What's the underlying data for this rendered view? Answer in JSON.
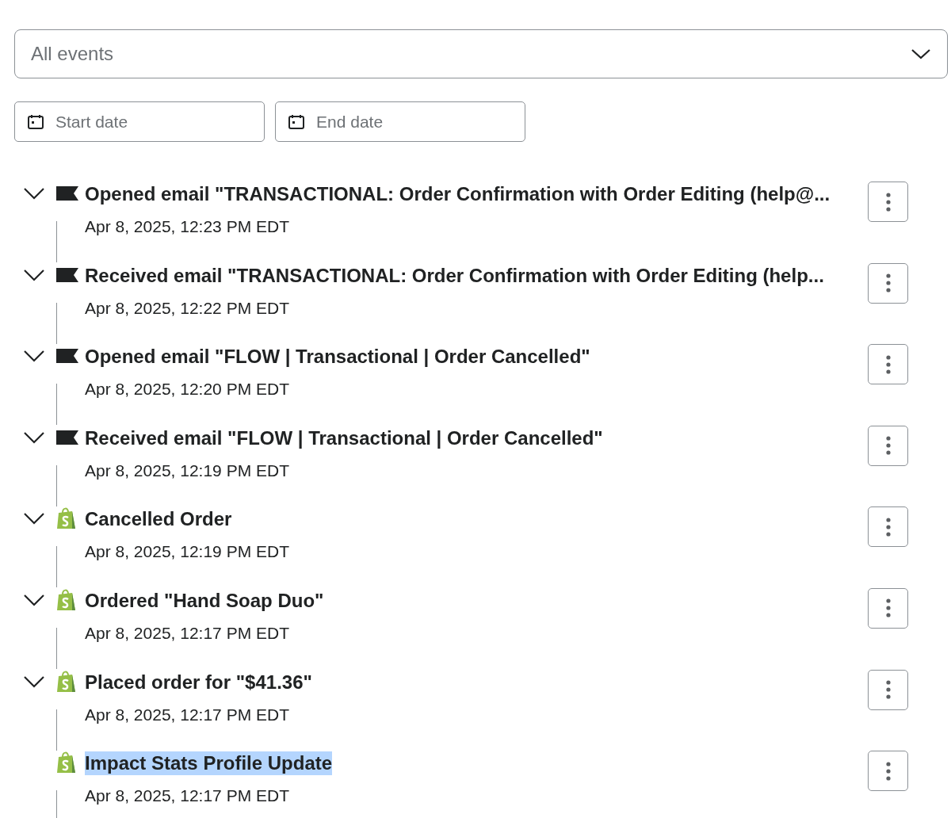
{
  "filter": {
    "event_select": {
      "value": "All events"
    },
    "start_date": {
      "placeholder": "Start date"
    },
    "end_date": {
      "placeholder": "End date"
    }
  },
  "events": [
    {
      "kind": "email",
      "expandable": true,
      "highlighted": false,
      "title": "Opened email \"TRANSACTIONAL: Order Confirmation with Order Editing (help@...",
      "time": "Apr 8, 2025, 12:23 PM EDT"
    },
    {
      "kind": "email",
      "expandable": true,
      "highlighted": false,
      "title": "Received email \"TRANSACTIONAL: Order Confirmation with Order Editing (help...",
      "time": "Apr 8, 2025, 12:22 PM EDT"
    },
    {
      "kind": "email",
      "expandable": true,
      "highlighted": false,
      "title": "Opened email \"FLOW | Transactional | Order Cancelled\"",
      "time": "Apr 8, 2025, 12:20 PM EDT"
    },
    {
      "kind": "email",
      "expandable": true,
      "highlighted": false,
      "title": "Received email \"FLOW | Transactional | Order Cancelled\"",
      "time": "Apr 8, 2025, 12:19 PM EDT"
    },
    {
      "kind": "shopify",
      "expandable": true,
      "highlighted": false,
      "title": "Cancelled Order",
      "time": "Apr 8, 2025, 12:19 PM EDT"
    },
    {
      "kind": "shopify",
      "expandable": true,
      "highlighted": false,
      "title": "Ordered \"Hand Soap Duo\"",
      "time": "Apr 8, 2025, 12:17 PM EDT"
    },
    {
      "kind": "shopify",
      "expandable": true,
      "highlighted": false,
      "title": "Placed order for \"$41.36\"",
      "time": "Apr 8, 2025, 12:17 PM EDT"
    },
    {
      "kind": "shopify",
      "expandable": false,
      "highlighted": true,
      "title": "Impact Stats Profile Update",
      "time": "Apr 8, 2025, 12:17 PM EDT"
    }
  ]
}
